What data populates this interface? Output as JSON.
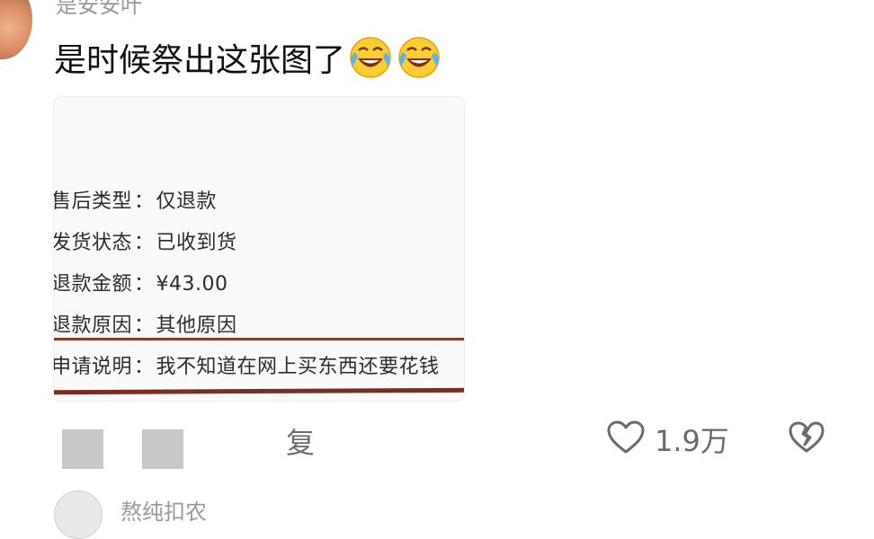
{
  "comment": {
    "username": "是安安叶",
    "text": "是时候祭出这张图了",
    "emojis": [
      "rolling-on-floor-laughing-icon",
      "rolling-on-floor-laughing-icon"
    ]
  },
  "image_content": {
    "rows": [
      {
        "label": "售后类型",
        "sep": "：",
        "value": "仅退款"
      },
      {
        "label": "发货状态",
        "sep": "：",
        "value": "已收到货"
      },
      {
        "label": "退款金额",
        "sep": "：",
        "value": "¥43.00"
      },
      {
        "label": "退款原因",
        "sep": "：",
        "value": "其他原因"
      },
      {
        "label": "申请说明",
        "sep": "：",
        "value": "我不知道在网上买东西还要花钱"
      }
    ]
  },
  "actions": {
    "reply_label": "复",
    "like_count": "1.9万"
  },
  "next_comment": {
    "username": "熬纯扣农"
  },
  "colors": {
    "accent_line": "#8a3d2e",
    "icon_gray": "#6b6b6b"
  }
}
